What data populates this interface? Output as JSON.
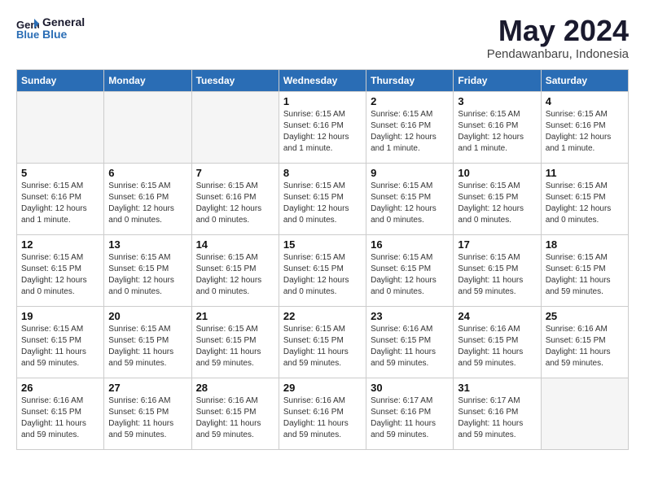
{
  "header": {
    "logo_line1": "General",
    "logo_line2": "Blue",
    "month": "May 2024",
    "location": "Pendawanbaru, Indonesia"
  },
  "weekdays": [
    "Sunday",
    "Monday",
    "Tuesday",
    "Wednesday",
    "Thursday",
    "Friday",
    "Saturday"
  ],
  "weeks": [
    [
      {
        "day": "",
        "info": ""
      },
      {
        "day": "",
        "info": ""
      },
      {
        "day": "",
        "info": ""
      },
      {
        "day": "1",
        "info": "Sunrise: 6:15 AM\nSunset: 6:16 PM\nDaylight: 12 hours\nand 1 minute."
      },
      {
        "day": "2",
        "info": "Sunrise: 6:15 AM\nSunset: 6:16 PM\nDaylight: 12 hours\nand 1 minute."
      },
      {
        "day": "3",
        "info": "Sunrise: 6:15 AM\nSunset: 6:16 PM\nDaylight: 12 hours\nand 1 minute."
      },
      {
        "day": "4",
        "info": "Sunrise: 6:15 AM\nSunset: 6:16 PM\nDaylight: 12 hours\nand 1 minute."
      }
    ],
    [
      {
        "day": "5",
        "info": "Sunrise: 6:15 AM\nSunset: 6:16 PM\nDaylight: 12 hours\nand 1 minute."
      },
      {
        "day": "6",
        "info": "Sunrise: 6:15 AM\nSunset: 6:16 PM\nDaylight: 12 hours\nand 0 minutes."
      },
      {
        "day": "7",
        "info": "Sunrise: 6:15 AM\nSunset: 6:16 PM\nDaylight: 12 hours\nand 0 minutes."
      },
      {
        "day": "8",
        "info": "Sunrise: 6:15 AM\nSunset: 6:15 PM\nDaylight: 12 hours\nand 0 minutes."
      },
      {
        "day": "9",
        "info": "Sunrise: 6:15 AM\nSunset: 6:15 PM\nDaylight: 12 hours\nand 0 minutes."
      },
      {
        "day": "10",
        "info": "Sunrise: 6:15 AM\nSunset: 6:15 PM\nDaylight: 12 hours\nand 0 minutes."
      },
      {
        "day": "11",
        "info": "Sunrise: 6:15 AM\nSunset: 6:15 PM\nDaylight: 12 hours\nand 0 minutes."
      }
    ],
    [
      {
        "day": "12",
        "info": "Sunrise: 6:15 AM\nSunset: 6:15 PM\nDaylight: 12 hours\nand 0 minutes."
      },
      {
        "day": "13",
        "info": "Sunrise: 6:15 AM\nSunset: 6:15 PM\nDaylight: 12 hours\nand 0 minutes."
      },
      {
        "day": "14",
        "info": "Sunrise: 6:15 AM\nSunset: 6:15 PM\nDaylight: 12 hours\nand 0 minutes."
      },
      {
        "day": "15",
        "info": "Sunrise: 6:15 AM\nSunset: 6:15 PM\nDaylight: 12 hours\nand 0 minutes."
      },
      {
        "day": "16",
        "info": "Sunrise: 6:15 AM\nSunset: 6:15 PM\nDaylight: 12 hours\nand 0 minutes."
      },
      {
        "day": "17",
        "info": "Sunrise: 6:15 AM\nSunset: 6:15 PM\nDaylight: 11 hours\nand 59 minutes."
      },
      {
        "day": "18",
        "info": "Sunrise: 6:15 AM\nSunset: 6:15 PM\nDaylight: 11 hours\nand 59 minutes."
      }
    ],
    [
      {
        "day": "19",
        "info": "Sunrise: 6:15 AM\nSunset: 6:15 PM\nDaylight: 11 hours\nand 59 minutes."
      },
      {
        "day": "20",
        "info": "Sunrise: 6:15 AM\nSunset: 6:15 PM\nDaylight: 11 hours\nand 59 minutes."
      },
      {
        "day": "21",
        "info": "Sunrise: 6:15 AM\nSunset: 6:15 PM\nDaylight: 11 hours\nand 59 minutes."
      },
      {
        "day": "22",
        "info": "Sunrise: 6:15 AM\nSunset: 6:15 PM\nDaylight: 11 hours\nand 59 minutes."
      },
      {
        "day": "23",
        "info": "Sunrise: 6:16 AM\nSunset: 6:15 PM\nDaylight: 11 hours\nand 59 minutes."
      },
      {
        "day": "24",
        "info": "Sunrise: 6:16 AM\nSunset: 6:15 PM\nDaylight: 11 hours\nand 59 minutes."
      },
      {
        "day": "25",
        "info": "Sunrise: 6:16 AM\nSunset: 6:15 PM\nDaylight: 11 hours\nand 59 minutes."
      }
    ],
    [
      {
        "day": "26",
        "info": "Sunrise: 6:16 AM\nSunset: 6:15 PM\nDaylight: 11 hours\nand 59 minutes."
      },
      {
        "day": "27",
        "info": "Sunrise: 6:16 AM\nSunset: 6:15 PM\nDaylight: 11 hours\nand 59 minutes."
      },
      {
        "day": "28",
        "info": "Sunrise: 6:16 AM\nSunset: 6:15 PM\nDaylight: 11 hours\nand 59 minutes."
      },
      {
        "day": "29",
        "info": "Sunrise: 6:16 AM\nSunset: 6:16 PM\nDaylight: 11 hours\nand 59 minutes."
      },
      {
        "day": "30",
        "info": "Sunrise: 6:17 AM\nSunset: 6:16 PM\nDaylight: 11 hours\nand 59 minutes."
      },
      {
        "day": "31",
        "info": "Sunrise: 6:17 AM\nSunset: 6:16 PM\nDaylight: 11 hours\nand 59 minutes."
      },
      {
        "day": "",
        "info": ""
      }
    ]
  ]
}
